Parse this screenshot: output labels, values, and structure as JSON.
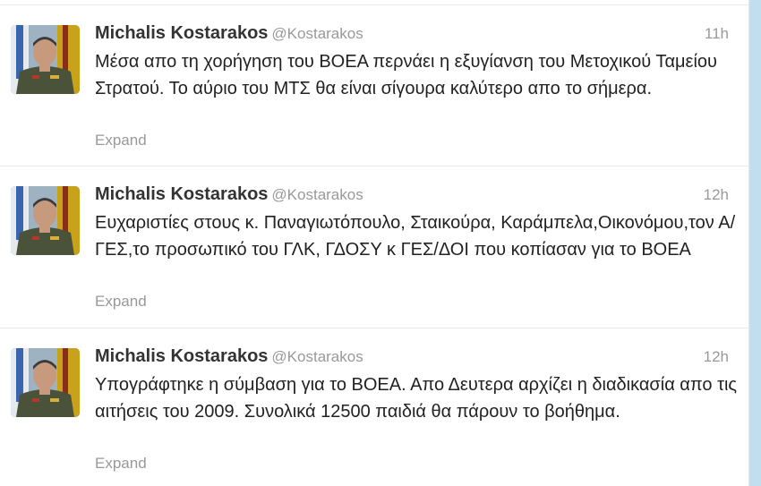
{
  "tweets": [
    {
      "fullname": "Michalis Kostarakos",
      "username": "@Kostarakos",
      "time": "11h",
      "text": "Μέσα απο τη χορήγηση του ΒΟΕΑ περνάει η εξυγίανση του Μετοχικού Ταμείου Στρατού. Το αύριο του ΜΤΣ θα είναι σίγουρα καλύτερο απο το σήμερα.",
      "expand_label": "Expand"
    },
    {
      "fullname": "Michalis Kostarakos",
      "username": "@Kostarakos",
      "time": "12h",
      "text": "Ευχαριστίες στους κ. Παναγιωτόπουλο, Σταικούρα, Καράμπελα,Οικονόμου,τον Α/ΓΕΣ,το προσωπικό του ΓΛΚ, ΓΔΟΣΥ κ ΓΕΣ/ΔΟΙ που κοπίασαν για το ΒΟΕΑ",
      "expand_label": "Expand"
    },
    {
      "fullname": "Michalis Kostarakos",
      "username": "@Kostarakos",
      "time": "12h",
      "text": "Υπογράφτηκε η σύμβαση για το ΒΟΕΑ. Απο Δευτερα αρχίζει η διαδικασία απο τις αιτήσεις του 2009. Συνολικά 12500 παιδιά θα πάρουν το βοήθημα.",
      "expand_label": "Expand"
    }
  ]
}
